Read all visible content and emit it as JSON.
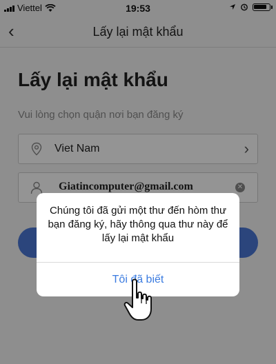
{
  "status_bar": {
    "carrier": "Viettel",
    "time": "19:53"
  },
  "nav": {
    "title": "Lấy lại mật khẩu"
  },
  "page": {
    "heading": "Lấy lại mật khẩu",
    "hint": "Vui lòng chọn quận nơi bạn đăng ký",
    "country_value": "Viet Nam",
    "email_value": "Giatincomputer@gmail.com"
  },
  "dialog": {
    "message": "Chúng tôi đã gửi một thư đến hòm thư bạn đăng ký, hãy thông qua thư này để lấy lại mật khẩu",
    "confirm_label": "Tôi đã biết"
  },
  "colors": {
    "accent": "#3a7be0",
    "button": "#4a78d6"
  }
}
